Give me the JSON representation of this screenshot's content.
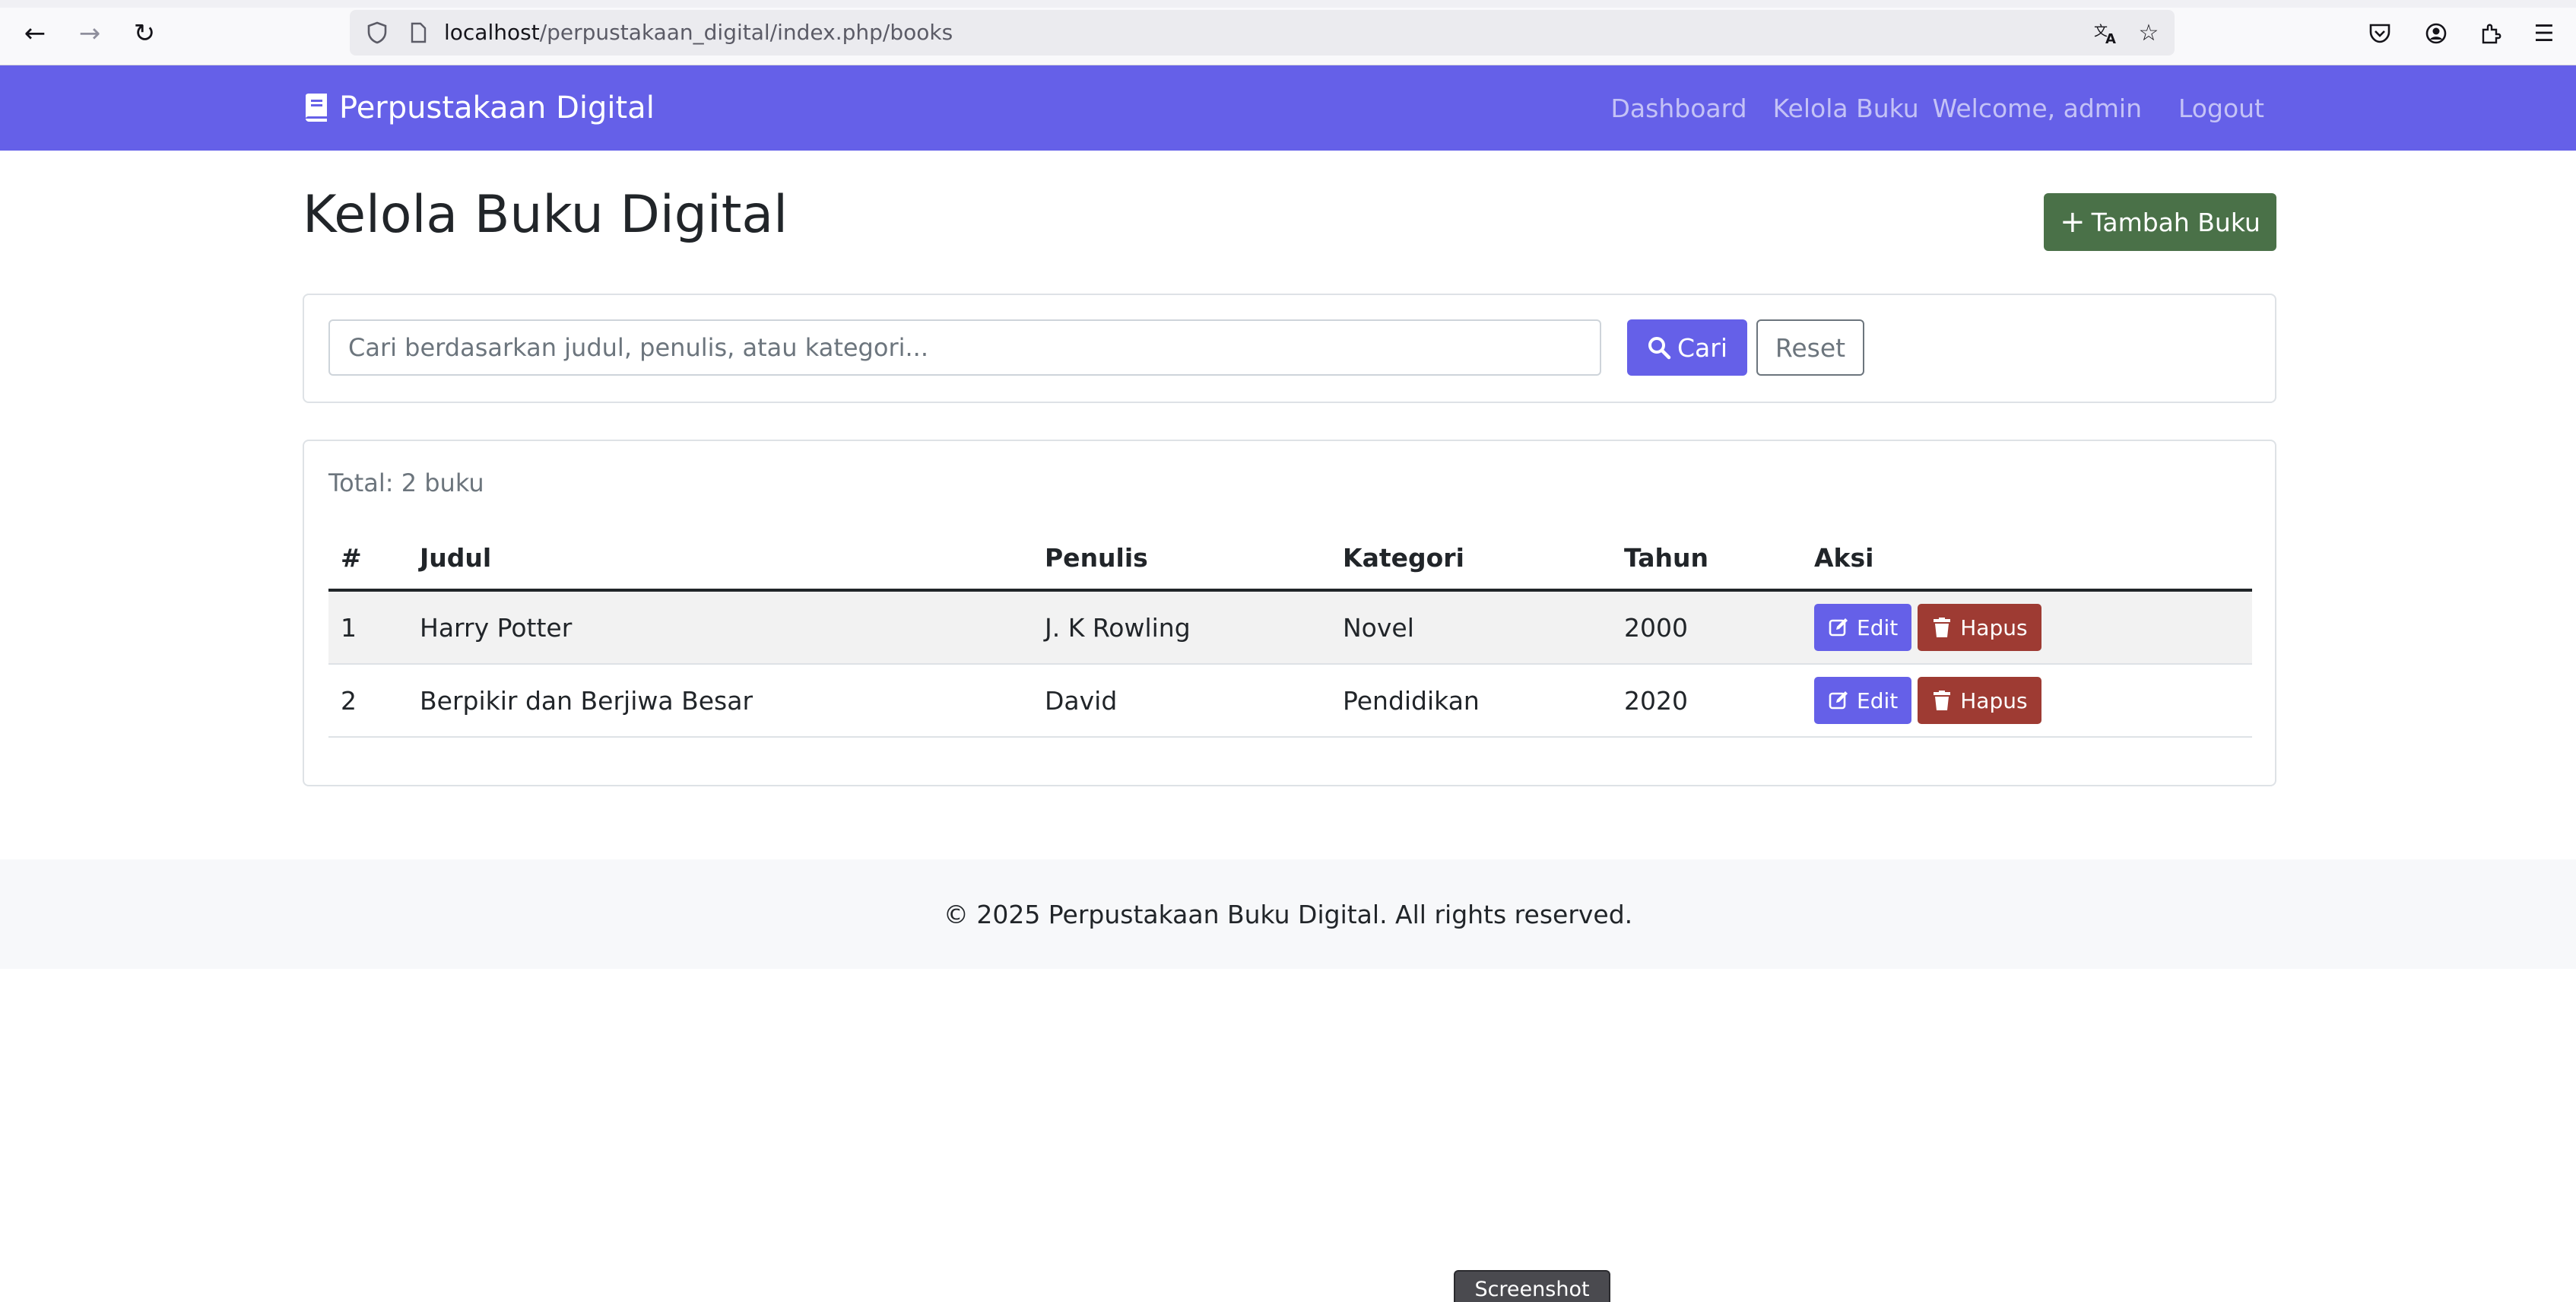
{
  "browser": {
    "url_host": "localhost",
    "url_path": "/perpustakaan_digital/index.php/books"
  },
  "navbar": {
    "brand": "Perpustakaan Digital",
    "links": [
      "Dashboard",
      "Kelola Buku"
    ],
    "welcome": "Welcome, admin",
    "logout": "Logout",
    "color": "#6560e8"
  },
  "main": {
    "title": "Kelola Buku Digital",
    "add_button": "Tambah Buku"
  },
  "search": {
    "placeholder": "Cari berdasarkan judul, penulis, atau kategori...",
    "submit_label": "Cari",
    "reset_label": "Reset"
  },
  "books": {
    "total_text": "Total: 2 buku",
    "columns": [
      "#",
      "Judul",
      "Penulis",
      "Kategori",
      "Tahun",
      "Aksi"
    ],
    "rows": [
      {
        "no": "1",
        "judul": "Harry Potter",
        "penulis": "J. K Rowling",
        "kategori": "Novel",
        "tahun": "2000"
      },
      {
        "no": "2",
        "judul": "Berpikir dan Berjiwa Besar",
        "penulis": "David",
        "kategori": "Pendidikan",
        "tahun": "2020"
      }
    ],
    "edit_label": "Edit",
    "delete_label": "Hapus"
  },
  "footer": {
    "text": "© 2025 Perpustakaan Buku Digital. All rights reserved."
  },
  "overlay": {
    "screenshot_label": "Screenshot"
  }
}
